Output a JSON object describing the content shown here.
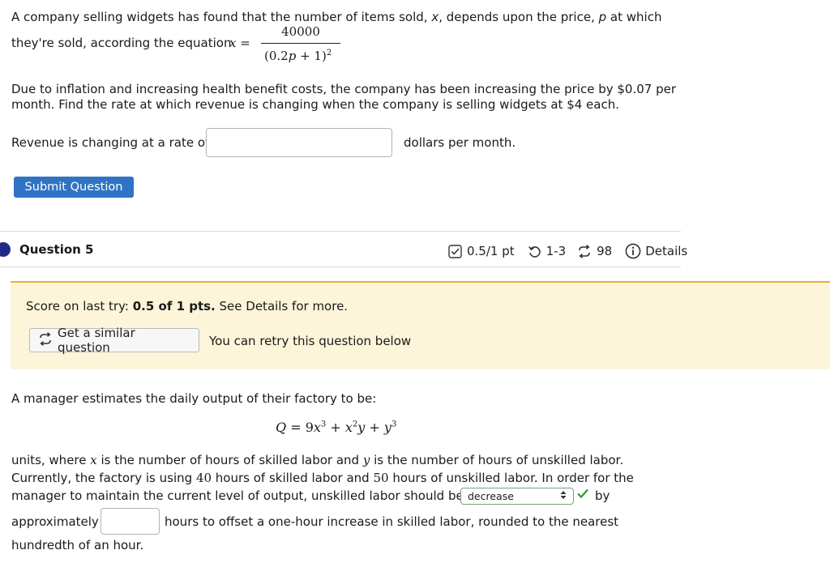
{
  "q4": {
    "intro_line1": "A company selling widgets has found that the number of items sold, x, depends upon the price, p at which",
    "intro_line2": "they're sold, according the equation",
    "equation_lhs": "x =",
    "fraction_numerator": "40000",
    "fraction_denominator": "(0.2p + 1)",
    "denominator_exponent": "2",
    "body_line1": "Due to inflation and increasing health benefit costs, the company has been increasing the price by $0.07 per",
    "body_line2": "month. Find the rate at which revenue is changing when the company is selling widgets at $4 each.",
    "answer_prefix": "Revenue is changing at a rate of",
    "answer_value": "",
    "answer_suffix": "dollars per month.",
    "submit_label": "Submit Question"
  },
  "q5": {
    "title": "Question 5",
    "score": "0.5/1 pt",
    "attempts": "1-3",
    "retries": "98",
    "details_label": "Details",
    "score_prefix": "Score on last try: ",
    "score_value": "0.5 of 1 pts.",
    "score_suffix": " See Details for more.",
    "similar_label": "Get a similar question",
    "retry_text": "You can retry this question below",
    "intro": "A manager estimates the daily output of their factory to be:",
    "equation": "Q = 9x³ + x²y + y³",
    "line1": "units, where x is the number of hours of skilled labor and y is the number of hours of unskilled labor.",
    "line2": "Currently, the factory is using 40 hours of skilled labor and 50 hours of unskilled labor. In order for the",
    "line3_prefix": "manager to maintain the current level of output, unskilled labor should be",
    "select_value": "decrease",
    "line3_suffix": "by",
    "line4_prefix": "approximately",
    "hours_value": "",
    "line4_suffix": "hours to offset a one-hour increase in skilled labor, rounded to the nearest",
    "line5": "hundredth of an hour."
  },
  "colors": {
    "button_blue": "#2f74c4",
    "panel_bg": "#fcf5d9",
    "panel_border": "#f2a93b",
    "correct_green": "#2e9a2e",
    "question_dot": "#1f2a8a"
  }
}
